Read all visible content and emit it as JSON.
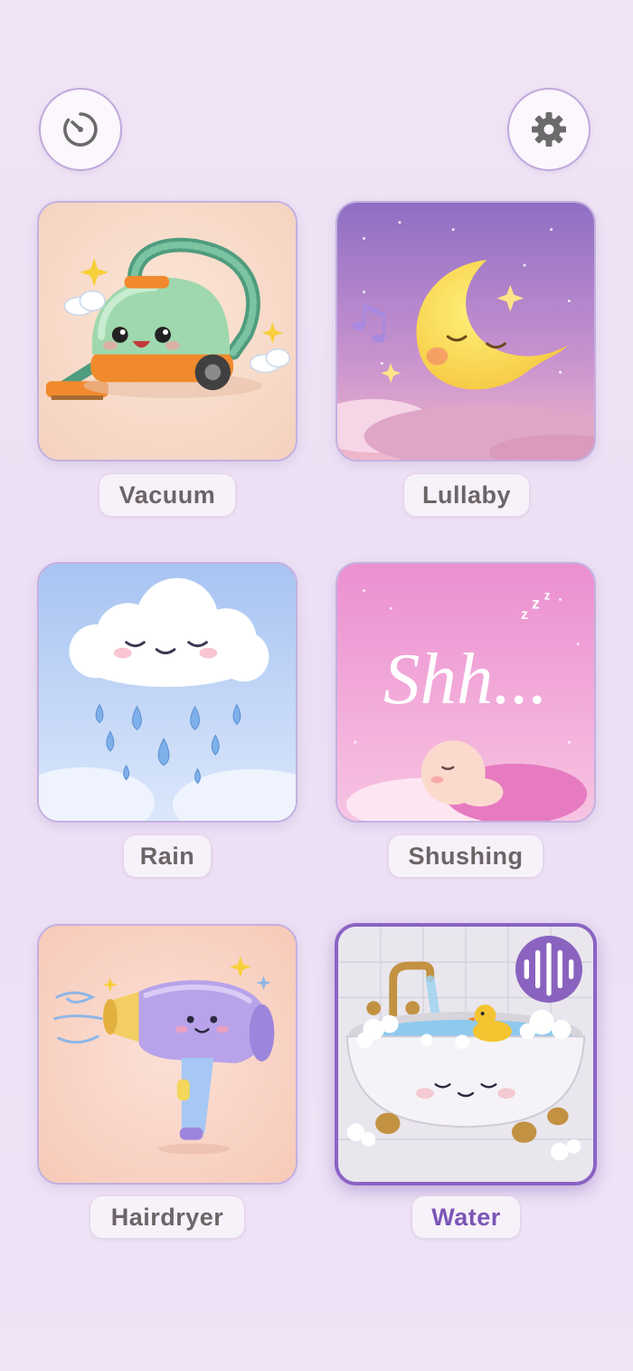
{
  "header": {
    "timer_icon": "timer-icon",
    "settings_icon": "gear-icon"
  },
  "sounds": [
    {
      "label": "Vacuum",
      "icon": "vacuum-icon"
    },
    {
      "label": "Lullaby",
      "icon": "moon-icon"
    },
    {
      "label": "Rain",
      "icon": "rain-cloud-icon"
    },
    {
      "label": "Shushing",
      "icon": "shushing-baby-icon"
    },
    {
      "label": "Hairdryer",
      "icon": "hairdryer-icon"
    },
    {
      "label": "Water",
      "icon": "bathtub-icon",
      "playing": true,
      "badge_icon": "sound-wave-icon"
    }
  ],
  "shush_text": "Shh...",
  "colors": {
    "accent": "#8a63c4",
    "active_label": "#7b55b5",
    "label_text": "#6c6466"
  }
}
